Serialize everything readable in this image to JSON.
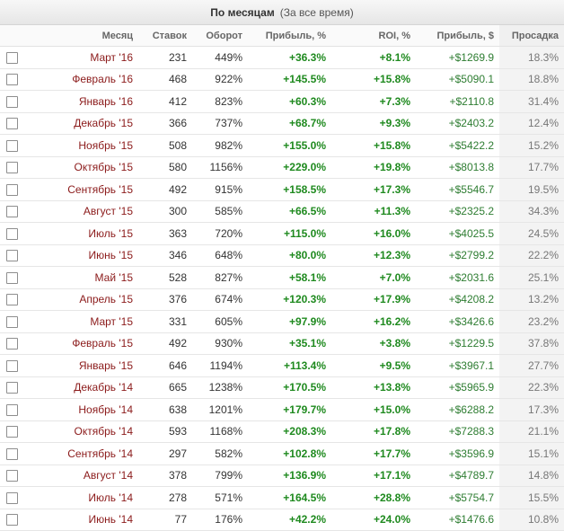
{
  "header": {
    "title": "По месяцам",
    "subtitle": "(За все время)"
  },
  "columns": {
    "month": "Месяц",
    "bets": "Ставок",
    "turnover": "Оборот",
    "profit_pct": "Прибыль, %",
    "roi": "ROI, %",
    "profit_usd": "Прибыль, $",
    "drawdown": "Просадка"
  },
  "rows": [
    {
      "month": "Март '16",
      "bets": "231",
      "turnover": "449%",
      "profit_pct": "+36.3%",
      "roi": "+8.1%",
      "profit_usd": "+$1269.9",
      "drawdown": "18.3%"
    },
    {
      "month": "Февраль '16",
      "bets": "468",
      "turnover": "922%",
      "profit_pct": "+145.5%",
      "roi": "+15.8%",
      "profit_usd": "+$5090.1",
      "drawdown": "18.8%"
    },
    {
      "month": "Январь '16",
      "bets": "412",
      "turnover": "823%",
      "profit_pct": "+60.3%",
      "roi": "+7.3%",
      "profit_usd": "+$2110.8",
      "drawdown": "31.4%"
    },
    {
      "month": "Декабрь '15",
      "bets": "366",
      "turnover": "737%",
      "profit_pct": "+68.7%",
      "roi": "+9.3%",
      "profit_usd": "+$2403.2",
      "drawdown": "12.4%"
    },
    {
      "month": "Ноябрь '15",
      "bets": "508",
      "turnover": "982%",
      "profit_pct": "+155.0%",
      "roi": "+15.8%",
      "profit_usd": "+$5422.2",
      "drawdown": "15.2%"
    },
    {
      "month": "Октябрь '15",
      "bets": "580",
      "turnover": "1156%",
      "profit_pct": "+229.0%",
      "roi": "+19.8%",
      "profit_usd": "+$8013.8",
      "drawdown": "17.7%"
    },
    {
      "month": "Сентябрь '15",
      "bets": "492",
      "turnover": "915%",
      "profit_pct": "+158.5%",
      "roi": "+17.3%",
      "profit_usd": "+$5546.7",
      "drawdown": "19.5%"
    },
    {
      "month": "Август '15",
      "bets": "300",
      "turnover": "585%",
      "profit_pct": "+66.5%",
      "roi": "+11.3%",
      "profit_usd": "+$2325.2",
      "drawdown": "34.3%"
    },
    {
      "month": "Июль '15",
      "bets": "363",
      "turnover": "720%",
      "profit_pct": "+115.0%",
      "roi": "+16.0%",
      "profit_usd": "+$4025.5",
      "drawdown": "24.5%"
    },
    {
      "month": "Июнь '15",
      "bets": "346",
      "turnover": "648%",
      "profit_pct": "+80.0%",
      "roi": "+12.3%",
      "profit_usd": "+$2799.2",
      "drawdown": "22.2%"
    },
    {
      "month": "Май '15",
      "bets": "528",
      "turnover": "827%",
      "profit_pct": "+58.1%",
      "roi": "+7.0%",
      "profit_usd": "+$2031.6",
      "drawdown": "25.1%"
    },
    {
      "month": "Апрель '15",
      "bets": "376",
      "turnover": "674%",
      "profit_pct": "+120.3%",
      "roi": "+17.9%",
      "profit_usd": "+$4208.2",
      "drawdown": "13.2%"
    },
    {
      "month": "Март '15",
      "bets": "331",
      "turnover": "605%",
      "profit_pct": "+97.9%",
      "roi": "+16.2%",
      "profit_usd": "+$3426.6",
      "drawdown": "23.2%"
    },
    {
      "month": "Февраль '15",
      "bets": "492",
      "turnover": "930%",
      "profit_pct": "+35.1%",
      "roi": "+3.8%",
      "profit_usd": "+$1229.5",
      "drawdown": "37.8%"
    },
    {
      "month": "Январь '15",
      "bets": "646",
      "turnover": "1194%",
      "profit_pct": "+113.4%",
      "roi": "+9.5%",
      "profit_usd": "+$3967.1",
      "drawdown": "27.7%"
    },
    {
      "month": "Декабрь '14",
      "bets": "665",
      "turnover": "1238%",
      "profit_pct": "+170.5%",
      "roi": "+13.8%",
      "profit_usd": "+$5965.9",
      "drawdown": "22.3%"
    },
    {
      "month": "Ноябрь '14",
      "bets": "638",
      "turnover": "1201%",
      "profit_pct": "+179.7%",
      "roi": "+15.0%",
      "profit_usd": "+$6288.2",
      "drawdown": "17.3%"
    },
    {
      "month": "Октябрь '14",
      "bets": "593",
      "turnover": "1168%",
      "profit_pct": "+208.3%",
      "roi": "+17.8%",
      "profit_usd": "+$7288.3",
      "drawdown": "21.1%"
    },
    {
      "month": "Сентябрь '14",
      "bets": "297",
      "turnover": "582%",
      "profit_pct": "+102.8%",
      "roi": "+17.7%",
      "profit_usd": "+$3596.9",
      "drawdown": "15.1%"
    },
    {
      "month": "Август '14",
      "bets": "378",
      "turnover": "799%",
      "profit_pct": "+136.9%",
      "roi": "+17.1%",
      "profit_usd": "+$4789.7",
      "drawdown": "14.8%"
    },
    {
      "month": "Июль '14",
      "bets": "278",
      "turnover": "571%",
      "profit_pct": "+164.5%",
      "roi": "+28.8%",
      "profit_usd": "+$5754.7",
      "drawdown": "15.5%"
    },
    {
      "month": "Июнь '14",
      "bets": "77",
      "turnover": "176%",
      "profit_pct": "+42.2%",
      "roi": "+24.0%",
      "profit_usd": "+$1476.6",
      "drawdown": "10.8%"
    }
  ],
  "colors": {
    "month_text": "#8b1a1a",
    "positive": "#1f8a1f",
    "header_bg": "#e6e6e6"
  }
}
